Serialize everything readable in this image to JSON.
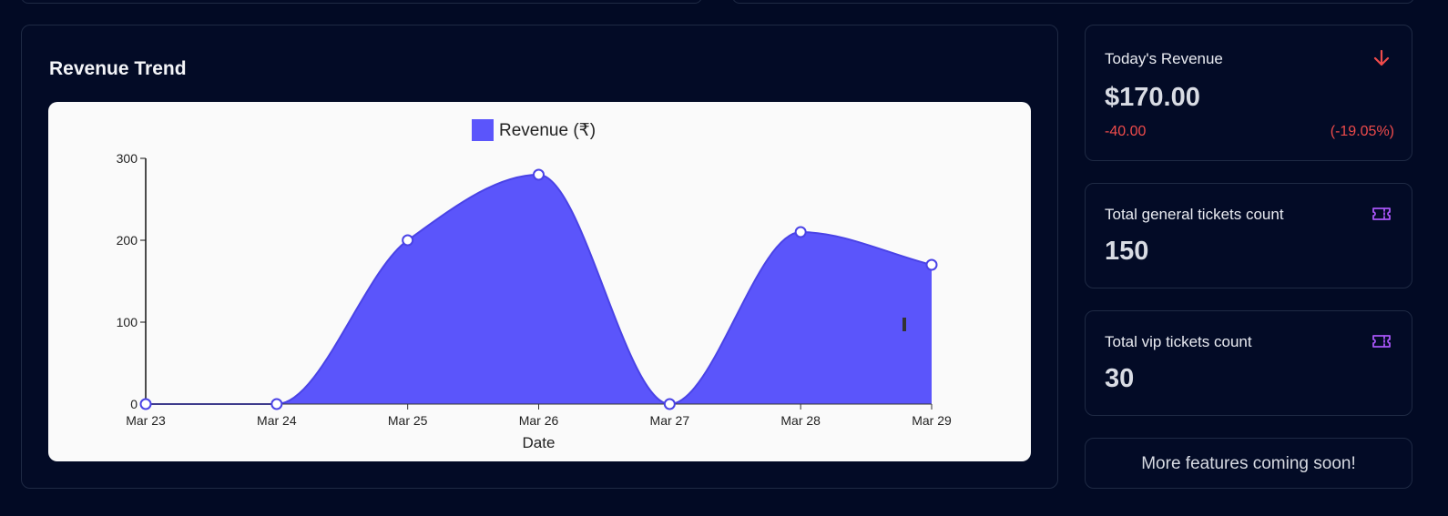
{
  "revenue_trend": {
    "title": "Revenue Trend"
  },
  "chart_data": {
    "type": "area",
    "title": "",
    "legend": [
      "Revenue (₹)"
    ],
    "legend_position": "top-center",
    "xlabel": "Date",
    "ylabel": "",
    "categories": [
      "Mar 23",
      "Mar 24",
      "Mar 25",
      "Mar 26",
      "Mar 27",
      "Mar 28",
      "Mar 29"
    ],
    "series": [
      {
        "name": "Revenue (₹)",
        "values": [
          0,
          0,
          200,
          280,
          0,
          210,
          170
        ],
        "color": "#5b55fb"
      }
    ],
    "yticks": [
      0,
      100,
      200,
      300
    ],
    "ylim": [
      0,
      300
    ],
    "grid": false,
    "smooth": true
  },
  "stats": {
    "todays_revenue": {
      "label": "Today's Revenue",
      "value": "$170.00",
      "change": "-40.00",
      "change_pct": "(-19.05%)",
      "icon": "arrow-down-icon",
      "icon_color": "#ef4b4b"
    },
    "general_tickets": {
      "label": "Total general tickets count",
      "value": "150",
      "icon": "ticket-icon",
      "icon_color": "#a855f7"
    },
    "vip_tickets": {
      "label": "Total vip tickets count",
      "value": "30",
      "icon": "ticket-icon",
      "icon_color": "#a855f7"
    }
  },
  "coming_soon": {
    "text": "More features coming soon!"
  },
  "colors": {
    "background": "#020a24",
    "panel_border": "#1f2a44",
    "accent": "#5b55fb",
    "negative": "#ef4b4b"
  }
}
